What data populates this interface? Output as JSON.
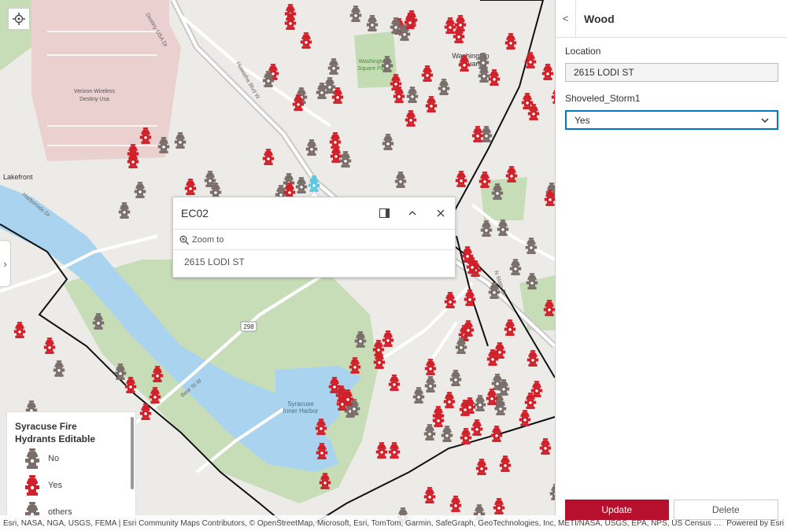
{
  "map": {
    "labels": {
      "verizon": [
        "Verizon Wireless",
        "Destiny Usa"
      ],
      "lakefront": "Lakefront",
      "washington_square_park": [
        "Washington",
        "Square Park"
      ],
      "washington_square": [
        "Washington",
        "Square"
      ],
      "inner_harbor": [
        "Syracuse",
        "Inner Harbor"
      ],
      "route": "298",
      "destiny_dr": "Destiny USA Dr",
      "harborside_dr": "Harborside Dr",
      "hiawatha_blvd": "Hiawatha Blvd W",
      "bear_st": "Bear St W",
      "n_salina": "N State St",
      "harbor": "Harbor"
    },
    "colors": {
      "water": "#a9d3ee",
      "park": "#c4dcb4",
      "land": "#ecebe8",
      "parking": "#e9c8c8",
      "boundary": "#111111",
      "hydrant_yes": "#d0202a",
      "hydrant_no": "#7a6e6a",
      "selected": "#5ac8e0"
    }
  },
  "popup": {
    "title": "EC02",
    "zoom_label": "Zoom to",
    "address": "2615 LODI ST"
  },
  "legend": {
    "title": "Syracuse Fire Hydrants Editable",
    "items": [
      {
        "label": "No",
        "icon": "hydrant-gray-icon"
      },
      {
        "label": "Yes",
        "icon": "hydrant-red-icon"
      },
      {
        "label": "others",
        "icon": "hydrant-gray-icon"
      }
    ]
  },
  "attribution": {
    "text": "Esri, NASA, NGA, USGS, FEMA | Esri Community Maps Contributors, © OpenStreetMap, Microsoft, Esri, TomTom, Garmin, SafeGraph, GeoTechnologies, Inc, METI/NASA, USGS, EPA, NPS, US Census Bureau, USDA, U...",
    "powered": "Powered by Esri"
  },
  "panel": {
    "title": "Wood",
    "back_icon": "<",
    "fields": {
      "location_label": "Location",
      "location_value": "2615 LODI ST",
      "shoveled_label": "Shoveled_Storm1",
      "shoveled_value": "Yes"
    },
    "buttons": {
      "update": "Update",
      "delete": "Delete"
    }
  }
}
